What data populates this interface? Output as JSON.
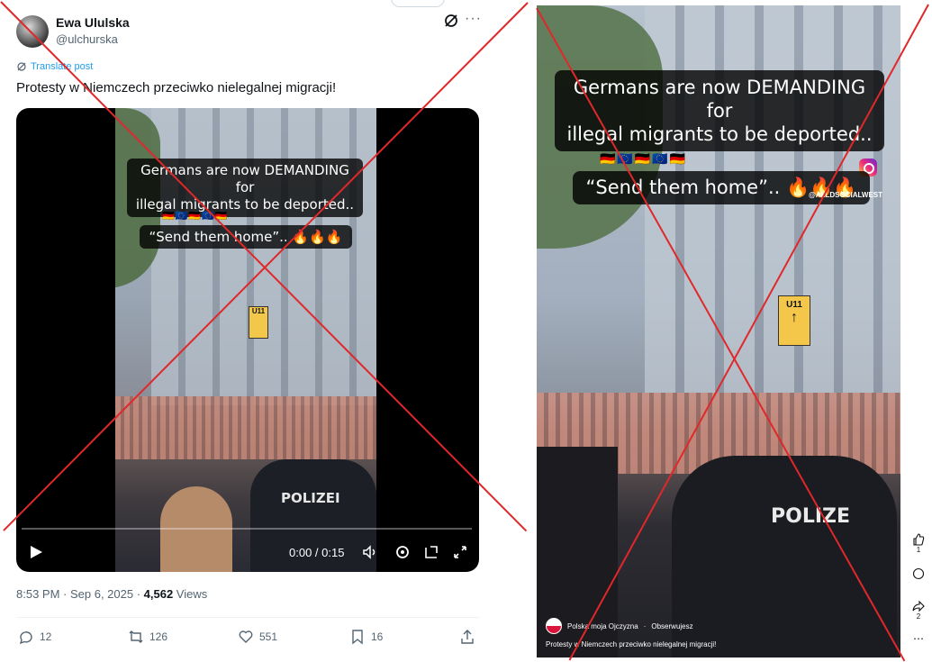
{
  "tweet": {
    "author_name": "Ewa Ululska",
    "author_handle": "@ulchurska",
    "translate_label": "Translate post",
    "text": "Protesty w Niemczech przeciwko nielegalnej migracji!",
    "video": {
      "caption_line1": "Germans are now DEMANDING for",
      "caption_line2": "illegal migrants to be deported..",
      "flags": "🇩🇪🇪🇺🇩🇪🇪🇺🇩🇪",
      "caption_line3": "“Send them home”.. 🔥🔥🔥",
      "sign_text": "U11",
      "police_text": "POLIZEI",
      "time": "0:00 / 0:15"
    },
    "timestamp": "8:53 PM · Sep 6, 2025 · ",
    "views_count": "4,562",
    "views_label": " Views",
    "actions": {
      "replies": "12",
      "reposts": "126",
      "likes": "551",
      "bookmarks": "16"
    }
  },
  "reel": {
    "caption_line1": "Germans are now DEMANDING for",
    "caption_line2": "illegal migrants to be deported..",
    "flags": "🇩🇪🇪🇺🇩🇪🇪🇺🇩🇪",
    "caption_line3": "“Send them home”.. 🔥🔥🔥",
    "watermark": "@ALLDSOCIALWEST",
    "sign_text": "U11",
    "police_text": "POLIZE",
    "account": "Polska moja Ojczyzna",
    "follow_label": "Obserwujesz",
    "caption": "Protesty w Niemczech przeciwko nielegalnej migracji!",
    "likes": "1",
    "shares": "2"
  },
  "colors": {
    "cross": "#e0282a",
    "link": "#1d9bf0",
    "muted": "#536471"
  }
}
